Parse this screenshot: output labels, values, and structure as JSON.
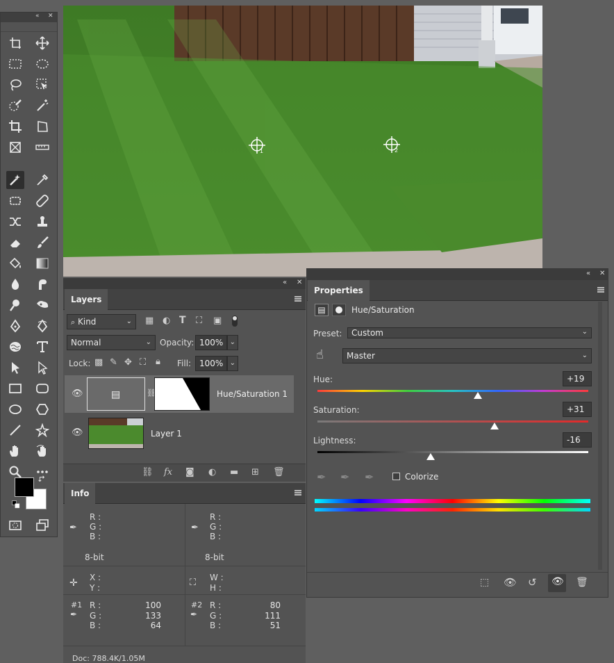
{
  "layers_panel": {
    "tab": "Layers",
    "filter_kind": "Kind",
    "blend_mode": "Normal",
    "opacity_label": "Opacity:",
    "opacity_value": "100%",
    "lock_label": "Lock:",
    "fill_label": "Fill:",
    "fill_value": "100%",
    "layers": [
      {
        "name": "Hue/Saturation 1"
      },
      {
        "name": "Layer 1"
      }
    ]
  },
  "info_panel": {
    "tab": "Info",
    "r_label": "R :",
    "g_label": "G :",
    "b_label": "B :",
    "bit_depth_left": "8-bit",
    "bit_depth_right": "8-bit",
    "x_label": "X :",
    "y_label": "Y :",
    "w_label": "W :",
    "h_label": "H :",
    "sampler1": {
      "tag": "#1",
      "r": "100",
      "g": "133",
      "b": "64"
    },
    "sampler2": {
      "tag": "#2",
      "r": "80",
      "g": "111",
      "b": "51"
    },
    "doc": "Doc: 788.4K/1.05M"
  },
  "properties_panel": {
    "tab": "Properties",
    "adjustment": "Hue/Saturation",
    "preset_label": "Preset:",
    "preset_value": "Custom",
    "channel": "Master",
    "hue_label": "Hue:",
    "hue_value": "+19",
    "saturation_label": "Saturation:",
    "saturation_value": "+31",
    "lightness_label": "Lightness:",
    "lightness_value": "-16",
    "colorize_label": "Colorize"
  },
  "canvas": {
    "samplers": [
      "1",
      "2"
    ]
  },
  "colors": {
    "panel_bg": "#535353",
    "foreground": "#000000",
    "background": "#ffffff"
  }
}
